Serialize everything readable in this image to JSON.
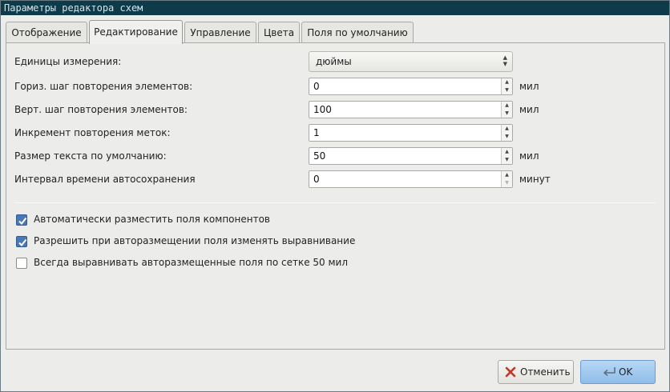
{
  "window": {
    "title": "Параметры редактора схем"
  },
  "tabs": [
    {
      "label": "Отображение"
    },
    {
      "label": "Редактирование",
      "active": true
    },
    {
      "label": "Управление"
    },
    {
      "label": "Цвета"
    },
    {
      "label": "Поля по умолчанию"
    }
  ],
  "settings": {
    "units": {
      "label": "Единицы измерения:",
      "value": "дюймы"
    },
    "h_repeat": {
      "label": "Гориз. шаг повторения элементов:",
      "value": "0",
      "unit": "мил"
    },
    "v_repeat": {
      "label": "Верт. шаг повторения элементов:",
      "value": "100",
      "unit": "мил"
    },
    "label_inc": {
      "label": "Инкремент повторения меток:",
      "value": "1"
    },
    "text_size": {
      "label": "Размер текста по умолчанию:",
      "value": "50",
      "unit": "мил"
    },
    "autosave": {
      "label": "Интервал времени автосохранения",
      "value": "0",
      "unit": "минут"
    }
  },
  "checkboxes": [
    {
      "label": "Автоматически разместить поля компонентов",
      "checked": true
    },
    {
      "label": "Разрешить при авторазмещении поля изменять выравнивание",
      "checked": true
    },
    {
      "label": "Всегда выравнивать авторазмещенные поля по сетке 50 мил",
      "checked": false
    }
  ],
  "buttons": {
    "cancel": "Отменить",
    "ok": "OK"
  },
  "colors": {
    "titlebar": "#0e3b4a",
    "accent": "#4a78b4",
    "ok_button": "#a3cbf0",
    "cancel_icon": "#c0392b"
  },
  "icons": {
    "cancel": "red-x-icon",
    "ok": "return-arrow-icon"
  }
}
